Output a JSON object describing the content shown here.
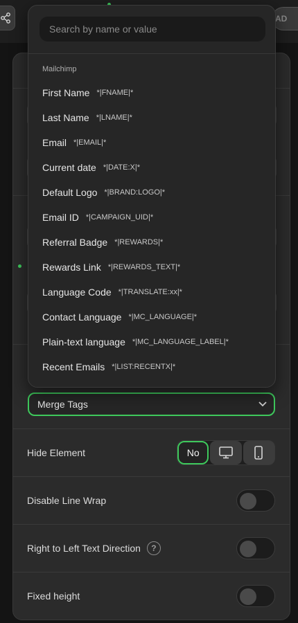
{
  "topbar": {
    "corner_label": "AD"
  },
  "dropdown": {
    "search_placeholder": "Search by name or value",
    "group_label": "Mailchimp",
    "items": [
      {
        "name": "First Name",
        "code": "*|FNAME|*"
      },
      {
        "name": "Last Name",
        "code": "*|LNAME|*"
      },
      {
        "name": "Email",
        "code": "*|EMAIL|*"
      },
      {
        "name": "Current date",
        "code": "*|DATE:X|*"
      },
      {
        "name": "Default Logo",
        "code": "*|BRAND:LOGO|*"
      },
      {
        "name": "Email ID",
        "code": "*|CAMPAIGN_UID|*"
      },
      {
        "name": "Referral Badge",
        "code": "*|REWARDS|*"
      },
      {
        "name": "Rewards Link",
        "code": "*|REWARDS_TEXT|*"
      },
      {
        "name": "Language Code",
        "code": "*|TRANSLATE:xx|*"
      },
      {
        "name": "Contact Language",
        "code": "*|MC_LANGUAGE|*"
      },
      {
        "name": "Plain-text language",
        "code": "*|MC_LANGUAGE_LABEL|*"
      },
      {
        "name": "Recent Emails",
        "code": "*|LIST:RECENTX|*"
      }
    ]
  },
  "merge_tags_select": {
    "label": "Merge Tags"
  },
  "settings": {
    "hide_element": {
      "label": "Hide Element",
      "no_label": "No"
    },
    "disable_line_wrap": {
      "label": "Disable Line Wrap",
      "on": false
    },
    "rtl": {
      "label": "Right to Left Text Direction",
      "help": "?",
      "on": false
    },
    "fixed_height": {
      "label": "Fixed height",
      "on": false
    }
  },
  "colors": {
    "accent": "#3ec95c",
    "panel": "#2b2b2b",
    "dropdown": "#262626"
  }
}
